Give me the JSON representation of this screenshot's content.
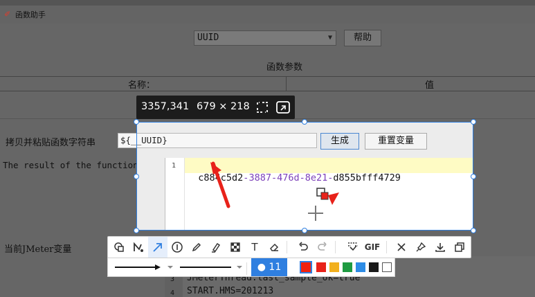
{
  "window": {
    "title": "函数助手"
  },
  "function_selector": {
    "value": "UUID"
  },
  "help_button": {
    "label": "帮助"
  },
  "section_title": "函数参数",
  "table": {
    "col_name": "名称：",
    "col_value": "值"
  },
  "copy_label": "拷贝并粘贴函数字符串",
  "function_string": "${__UUID}",
  "generate_button": {
    "label": "生成"
  },
  "reset_button": {
    "label": "重置变量"
  },
  "result_label": "The result of the function is",
  "result_editor": {
    "line_number": "1",
    "segments": [
      {
        "text": "c884c5d2",
        "kind": "normal"
      },
      {
        "text": "-",
        "kind": "dash"
      },
      {
        "text": "3887",
        "kind": "dash"
      },
      {
        "text": "-",
        "kind": "dash"
      },
      {
        "text": "476d",
        "kind": "dash"
      },
      {
        "text": "-",
        "kind": "dash"
      },
      {
        "text": "8e21",
        "kind": "dash"
      },
      {
        "text": "-",
        "kind": "dash"
      },
      {
        "text": "d855bfff4729",
        "kind": "normal"
      }
    ]
  },
  "jmeter_vars": {
    "label": "当前JMeter变量",
    "lines": [
      {
        "n": "3",
        "text": "JMeterThread.last_sample_ok=true"
      },
      {
        "n": "4",
        "text": "START.HMS=201213"
      }
    ]
  },
  "capture": {
    "position": "3357,341",
    "size": "679 × 218"
  },
  "annotation_toolbar": {
    "tools": [
      "shape-icon",
      "polyline-icon",
      "arrow-icon",
      "number-marker-icon",
      "pen-icon",
      "highlighter-icon",
      "mosaic-icon",
      "text-icon",
      "eraser-icon",
      "undo-icon",
      "redo-icon",
      "scan-icon",
      "gif-icon",
      "close-icon",
      "pin-icon",
      "download-icon",
      "copy-icon"
    ],
    "gif_label": "GIF",
    "text_tool_label": "T",
    "stroke_size": "11",
    "colors": [
      "#f0220f",
      "#e8221a",
      "#f2b01e",
      "#1e9b41",
      "#2d8ce6",
      "#1a1a1a",
      "#ffffff"
    ],
    "selected_color": "#f0220f",
    "accent": "#2f7fe0"
  }
}
